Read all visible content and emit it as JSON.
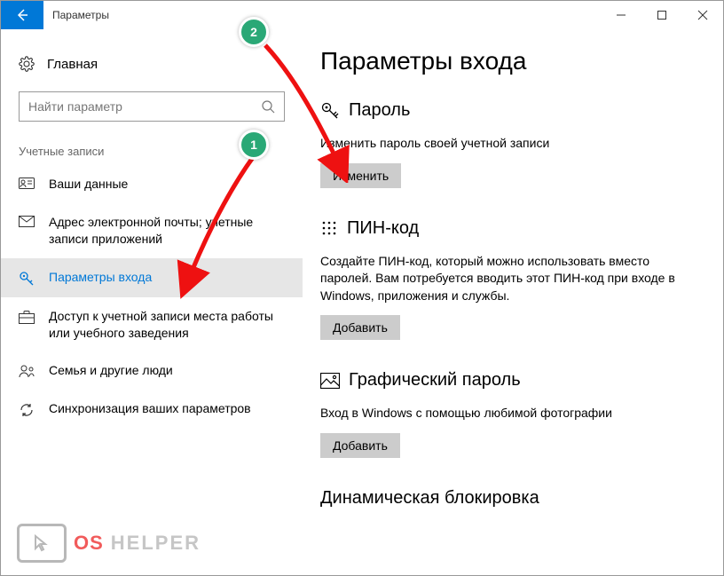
{
  "window": {
    "title": "Параметры"
  },
  "sidebar": {
    "home": "Главная",
    "search_placeholder": "Найти параметр",
    "section": "Учетные записи",
    "items": [
      {
        "label": "Ваши данные"
      },
      {
        "label": "Адрес электронной почты; учетные записи приложений"
      },
      {
        "label": "Параметры входа"
      },
      {
        "label": "Доступ к учетной записи места работы или учебного заведения"
      },
      {
        "label": "Семья и другие люди"
      },
      {
        "label": "Синхронизация ваших параметров"
      }
    ]
  },
  "main": {
    "page_title": "Параметры входа",
    "password": {
      "heading": "Пароль",
      "desc": "Изменить пароль своей учетной записи",
      "button": "Изменить"
    },
    "pin": {
      "heading": "ПИН-код",
      "desc": "Создайте ПИН-код, который можно использовать вместо паролей. Вам потребуется вводить этот ПИН-код при входе в Windows, приложения и службы.",
      "button": "Добавить"
    },
    "picture": {
      "heading": "Графический пароль",
      "desc": "Вход в Windows с помощью любимой фотографии",
      "button": "Добавить"
    },
    "dynamic_lock": {
      "heading": "Динамическая блокировка"
    }
  },
  "annotations": {
    "marker1": "1",
    "marker2": "2"
  },
  "watermark": {
    "os": "OS",
    "helper": "HELPER"
  }
}
